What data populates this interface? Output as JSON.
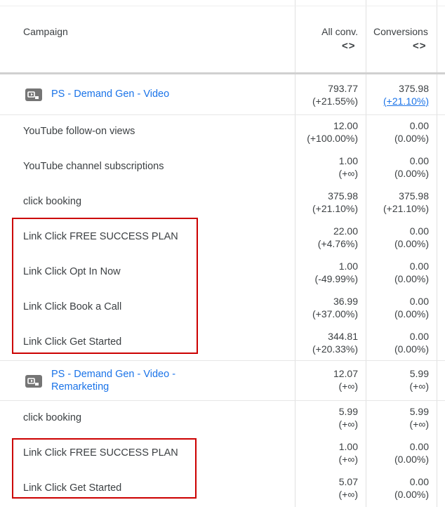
{
  "header": {
    "campaign": "Campaign",
    "all_conv": "All conv.",
    "conversions": "Conversions",
    "sort_glyph": "<>"
  },
  "rows": [
    {
      "type": "campaign",
      "name_line1": "PS - Demand Gen - Video",
      "name_line2": "",
      "all_conv": "793.77",
      "all_conv_pct": "(+21.55%)",
      "conv": "375.98",
      "conv_pct": "(+21.10%)"
    },
    {
      "type": "action",
      "name": "YouTube follow-on views",
      "all_conv": "12.00",
      "all_conv_pct": "(+100.00%)",
      "conv": "0.00",
      "conv_pct": "(0.00%)"
    },
    {
      "type": "action",
      "name": "YouTube channel subscriptions",
      "all_conv": "1.00",
      "all_conv_pct": "(+∞)",
      "conv": "0.00",
      "conv_pct": "(0.00%)"
    },
    {
      "type": "action",
      "name": "click booking",
      "all_conv": "375.98",
      "all_conv_pct": "(+21.10%)",
      "conv": "375.98",
      "conv_pct": "(+21.10%)"
    },
    {
      "type": "action",
      "name": "Link Click FREE SUCCESS PLAN",
      "all_conv": "22.00",
      "all_conv_pct": "(+4.76%)",
      "conv": "0.00",
      "conv_pct": "(0.00%)"
    },
    {
      "type": "action",
      "name": "Link Click Opt In Now",
      "all_conv": "1.00",
      "all_conv_pct": "(-49.99%)",
      "conv": "0.00",
      "conv_pct": "(0.00%)"
    },
    {
      "type": "action",
      "name": "Link Click Book a Call",
      "all_conv": "36.99",
      "all_conv_pct": "(+37.00%)",
      "conv": "0.00",
      "conv_pct": "(0.00%)"
    },
    {
      "type": "action",
      "name": "Link Click Get Started",
      "all_conv": "344.81",
      "all_conv_pct": "(+20.33%)",
      "conv": "0.00",
      "conv_pct": "(0.00%)"
    },
    {
      "type": "campaign",
      "name_line1": "PS - Demand Gen - Video -",
      "name_line2": "Remarketing",
      "all_conv": "12.07",
      "all_conv_pct": "(+∞)",
      "conv": "5.99",
      "conv_pct": "(+∞)"
    },
    {
      "type": "action",
      "name": "click booking",
      "all_conv": "5.99",
      "all_conv_pct": "(+∞)",
      "conv": "5.99",
      "conv_pct": "(+∞)"
    },
    {
      "type": "action",
      "name": "Link Click FREE SUCCESS PLAN",
      "all_conv": "1.00",
      "all_conv_pct": "(+∞)",
      "conv": "0.00",
      "conv_pct": "(0.00%)"
    },
    {
      "type": "action",
      "name": "Link Click Get Started",
      "all_conv": "5.07",
      "all_conv_pct": "(+∞)",
      "conv": "0.00",
      "conv_pct": "(0.00%)"
    }
  ],
  "colors": {
    "link": "#1a73e8",
    "text": "#3c4043",
    "highlight": "#cc0000"
  },
  "icons": {
    "campaign": "video-campaign-icon",
    "sort": "sort-icon"
  }
}
